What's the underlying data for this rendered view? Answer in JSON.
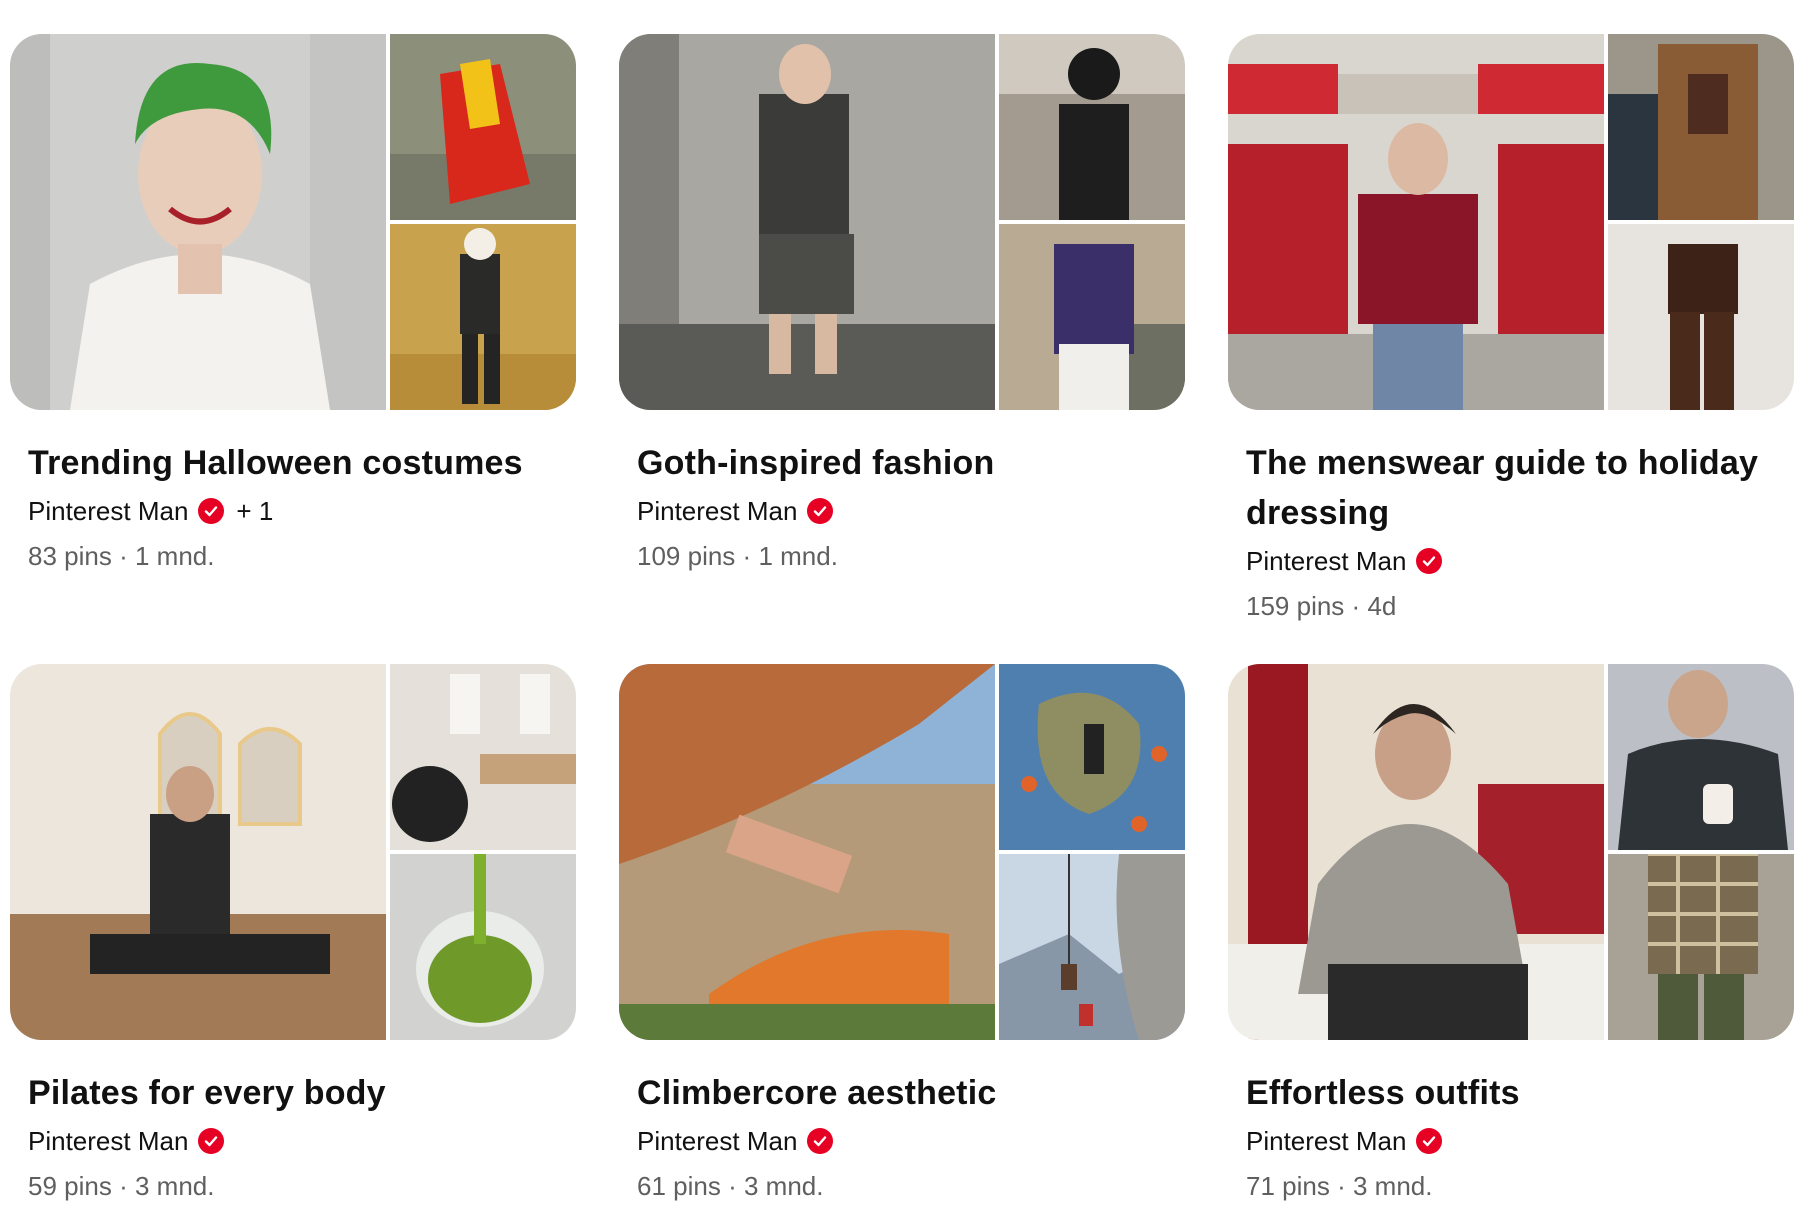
{
  "boards": [
    {
      "title": "Trending Halloween costumes",
      "owner": "Pinterest Man",
      "extra": "+ 1",
      "pins": "83 pins",
      "sep": "·",
      "age": "1 mnd.",
      "images": [
        "joker-portrait-photo",
        "red-costume-photo",
        "autumn-suit-photo"
      ]
    },
    {
      "title": "Goth-inspired fashion",
      "owner": "Pinterest Man",
      "extra": "",
      "pins": "109 pins",
      "sep": "·",
      "age": "1 mnd.",
      "images": [
        "black-vest-street-photo",
        "leather-jacket-store-photo",
        "striped-blazer-photo"
      ]
    },
    {
      "title": "The menswear guide to holiday dressing",
      "owner": "Pinterest Man",
      "extra": "",
      "pins": "159 pins",
      "sep": "·",
      "age": "4d",
      "images": [
        "red-sweater-storefront-photo",
        "brown-suit-car-photo",
        "brown-outfit-photo"
      ]
    },
    {
      "title": "Pilates for every body",
      "owner": "Pinterest Man",
      "extra": "",
      "pins": "59 pins",
      "sep": "·",
      "age": "3 mnd.",
      "images": [
        "pilates-studio-selfie-photo",
        "reformer-ball-photo",
        "green-juice-photo"
      ]
    },
    {
      "title": "Climbercore aesthetic",
      "owner": "Pinterest Man",
      "extra": "",
      "pins": "61 pins",
      "sep": "·",
      "age": "3 mnd.",
      "images": [
        "boulder-climber-photo",
        "climbing-wall-photo",
        "rappel-cliff-photo"
      ]
    },
    {
      "title": "Effortless outfits",
      "owner": "Pinterest Man",
      "extra": "",
      "pins": "71 pins",
      "sep": "·",
      "age": "3 mnd.",
      "images": [
        "grey-sweater-cafe-photo",
        "oversized-shirt-coffee-photo",
        "plaid-overshirt-photo"
      ]
    }
  ],
  "colors": {
    "verified": "#e60023",
    "meta_text": "#5f5f5f",
    "title_text": "#111111"
  },
  "icons": {
    "verified": "verified-check-icon"
  }
}
